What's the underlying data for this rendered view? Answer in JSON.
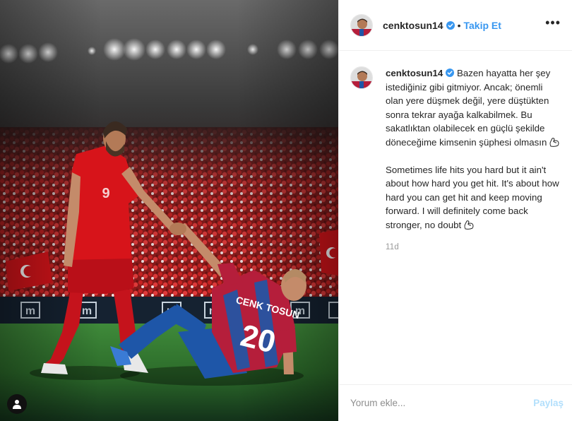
{
  "post": {
    "username": "cenktosun14",
    "follow_label": "Takip Et",
    "dot": "•",
    "more_label": "•••",
    "image_alt": "Cenk Tosun helping up a fallen player in front of a stadium crowd",
    "player_standing_number": "9",
    "player_fallen_name": "CENK TOSUN",
    "player_fallen_number": "20",
    "board_letter": "m"
  },
  "caption": {
    "username": "cenktosun14",
    "paragraph_tr": "Bazen hayatta her şey istediğiniz gibi gitmiyor. Ancak; önemli olan yere düşmek değil, yere düştükten sonra tekrar ayağa kalkabilmek. Bu sakatlıktan olabilecek en güçlü şekilde döneceğime kimsenin şüphesi olmasın",
    "paragraph_en": "Sometimes life hits you hard but it ain't about how hard you get hit. It's about how hard you can get hit and keep moving forward. I will definitely come back stronger, no doubt",
    "timestamp": "11d"
  },
  "comment": {
    "placeholder": "Yorum ekle...",
    "post_label": "Paylaş"
  },
  "colors": {
    "follow": "#3897f0",
    "post_disabled": "#b2dffc",
    "verified": "#3897f0",
    "turkey_red": "#d7141a"
  },
  "icons": {
    "verified": "verified-badge-icon",
    "muscle": "flexed-biceps-icon",
    "user_tag": "user-tag-icon",
    "more": "more-options-icon"
  }
}
